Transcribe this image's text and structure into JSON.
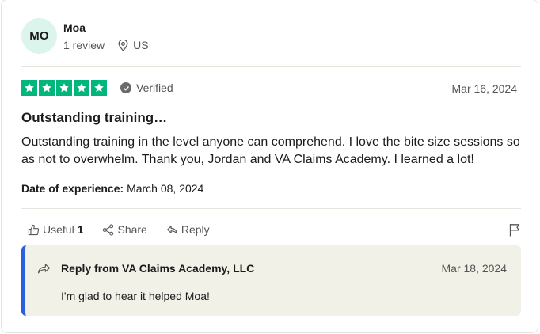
{
  "reviewer": {
    "initials": "MO",
    "name": "Moa",
    "review_count": "1 review",
    "country": "US"
  },
  "review": {
    "rating": 5,
    "verified_label": "Verified",
    "date": "Mar 16, 2024",
    "title": "Outstanding training…",
    "body": "Outstanding training in the level anyone can comprehend. I love the bite size sessions so as not to overwhelm. Thank you, Jordan and VA Claims Academy. I learned a lot!",
    "experience_label": "Date of experience:",
    "experience_date": "March 08, 2024"
  },
  "actions": {
    "useful_label": "Useful",
    "useful_count": "1",
    "share_label": "Share",
    "reply_label": "Reply"
  },
  "reply": {
    "from": "Reply from VA Claims Academy, LLC",
    "date": "Mar 18, 2024",
    "text": "I'm glad to hear it helped Moa!"
  },
  "colors": {
    "star_green": "#00b67a",
    "reply_accent": "#2c5fdd",
    "reply_bg": "#f1f1e8",
    "avatar_bg": "#dcf5ec"
  },
  "icons": {
    "location": "location-pin-icon",
    "verified": "check-circle-icon",
    "useful": "thumbs-up-icon",
    "share": "share-icon",
    "reply": "reply-arrow-icon",
    "flag": "flag-icon"
  }
}
